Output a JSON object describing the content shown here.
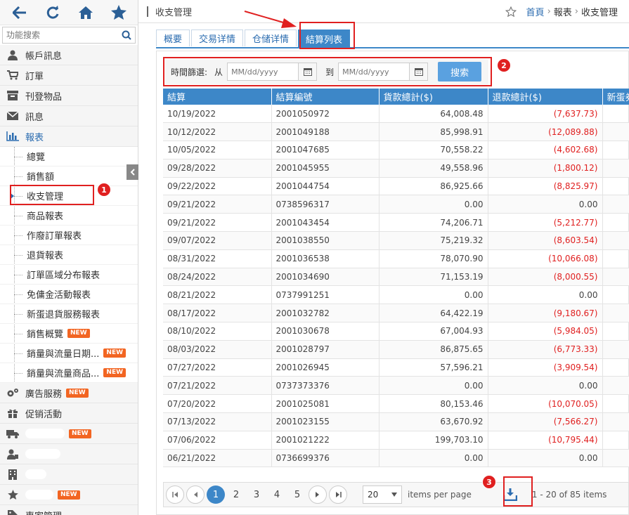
{
  "sidebar": {
    "search_placeholder": "功能搜索",
    "menu_top": [
      {
        "label": "帳戶訊息",
        "icon": "user-icon"
      },
      {
        "label": "訂單",
        "icon": "cart-icon"
      },
      {
        "label": "刊登物品",
        "icon": "archive-icon"
      },
      {
        "label": "訊息",
        "icon": "envelope-icon"
      },
      {
        "label": "報表",
        "icon": "bar-chart-icon"
      }
    ],
    "sub_items": [
      "總覽",
      "銷售額",
      "收支管理",
      "商品報表",
      "作廢訂單報表",
      "退貨報表",
      "訂單區域分布報表",
      "免傭金活動報表",
      "新蛋退貨服務報表",
      "銷售概覽",
      "銷量與流量日期...",
      "銷量與流量商品..."
    ],
    "menu_bottom": [
      {
        "label": "廣告服務",
        "icon": "gears-icon"
      },
      {
        "label": "促销活動",
        "icon": "gift-icon"
      }
    ],
    "badge": "NEW",
    "last_item": "專家管理"
  },
  "header": {
    "title": "收支管理",
    "breadcrumb_home": "首頁",
    "breadcrumb_reports": "報表",
    "breadcrumb_current": "收支管理",
    "sep": "›"
  },
  "tabs": [
    "概要",
    "交易详情",
    "仓储详情",
    "結算列表"
  ],
  "filter": {
    "label": "時間篩選:",
    "from": "从",
    "to": "到",
    "date_placeholder": "MM/dd/yyyy",
    "search": "搜索"
  },
  "table": {
    "columns": [
      "結算",
      "結算編號",
      "貨款總計($)",
      "退款總計($)",
      "新蛋券"
    ],
    "rows": [
      [
        "10/19/2022",
        "2001050972",
        "64,008.48",
        "(7,637.73)"
      ],
      [
        "10/12/2022",
        "2001049188",
        "85,998.91",
        "(12,089.88)"
      ],
      [
        "10/05/2022",
        "2001047685",
        "70,558.22",
        "(4,602.68)"
      ],
      [
        "09/28/2022",
        "2001045955",
        "49,558.96",
        "(1,800.12)"
      ],
      [
        "09/22/2022",
        "2001044754",
        "86,925.66",
        "(8,825.97)"
      ],
      [
        "09/21/2022",
        "0738596317",
        "0.00",
        "0.00"
      ],
      [
        "09/21/2022",
        "2001043454",
        "74,206.71",
        "(5,212.77)"
      ],
      [
        "09/07/2022",
        "2001038550",
        "75,219.32",
        "(8,603.54)"
      ],
      [
        "08/31/2022",
        "2001036538",
        "78,070.90",
        "(10,066.08)"
      ],
      [
        "08/24/2022",
        "2001034690",
        "71,153.19",
        "(8,000.55)"
      ],
      [
        "08/21/2022",
        "0737991251",
        "0.00",
        "0.00"
      ],
      [
        "08/17/2022",
        "2001032782",
        "64,422.19",
        "(9,180.67)"
      ],
      [
        "08/10/2022",
        "2001030678",
        "67,004.93",
        "(5,984.05)"
      ],
      [
        "08/03/2022",
        "2001028797",
        "86,875.65",
        "(6,773.33)"
      ],
      [
        "07/27/2022",
        "2001026945",
        "57,596.21",
        "(3,909.54)"
      ],
      [
        "07/21/2022",
        "0737373376",
        "0.00",
        "0.00"
      ],
      [
        "07/20/2022",
        "2001025081",
        "80,153.46",
        "(10,070.05)"
      ],
      [
        "07/13/2022",
        "2001023155",
        "63,670.92",
        "(7,566.27)"
      ],
      [
        "07/06/2022",
        "2001021222",
        "199,703.10",
        "(10,795.44)"
      ],
      [
        "06/21/2022",
        "0736699376",
        "0.00",
        "0.00"
      ]
    ]
  },
  "pager": {
    "pages": [
      "1",
      "2",
      "3",
      "4",
      "5"
    ],
    "current": "1",
    "page_size": "20",
    "per_page_label": "items per page",
    "info": "1 - 20 of 85 items"
  },
  "annotations": [
    "1",
    "2",
    "3"
  ],
  "colors": {
    "accent": "#3d87c8",
    "negative": "#e02020",
    "annotation": "#e02020",
    "badge": "#f26522"
  }
}
